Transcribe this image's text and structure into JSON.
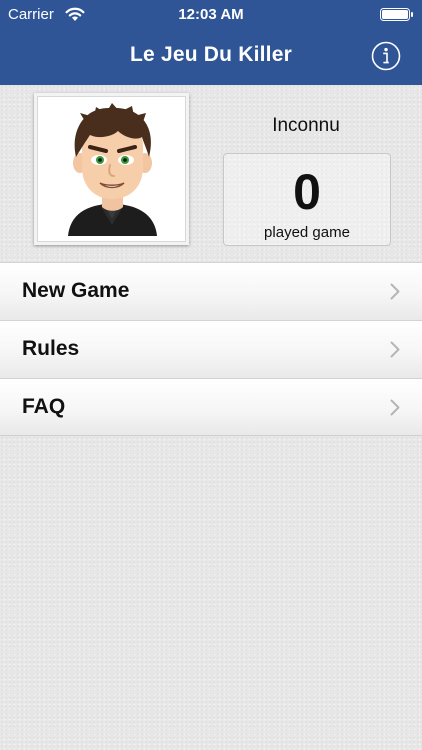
{
  "status_bar": {
    "carrier": "Carrier",
    "time": "12:03 AM",
    "wifi_icon": "wifi-icon",
    "battery_icon": "battery-icon"
  },
  "nav": {
    "title": "Le Jeu Du Killer",
    "info_icon": "info-icon"
  },
  "profile": {
    "name": "Inconnu",
    "played_count": "0",
    "played_label": "played game",
    "avatar_icon": "avatar-icon"
  },
  "menu": {
    "items": [
      {
        "label": "New Game",
        "icon": "chevron-right-icon"
      },
      {
        "label": "Rules",
        "icon": "chevron-right-icon"
      },
      {
        "label": "FAQ",
        "icon": "chevron-right-icon"
      }
    ]
  },
  "colors": {
    "nav_background": "#2f5597",
    "page_background": "#e7e7e7",
    "chevron": "#b5b5b5"
  }
}
